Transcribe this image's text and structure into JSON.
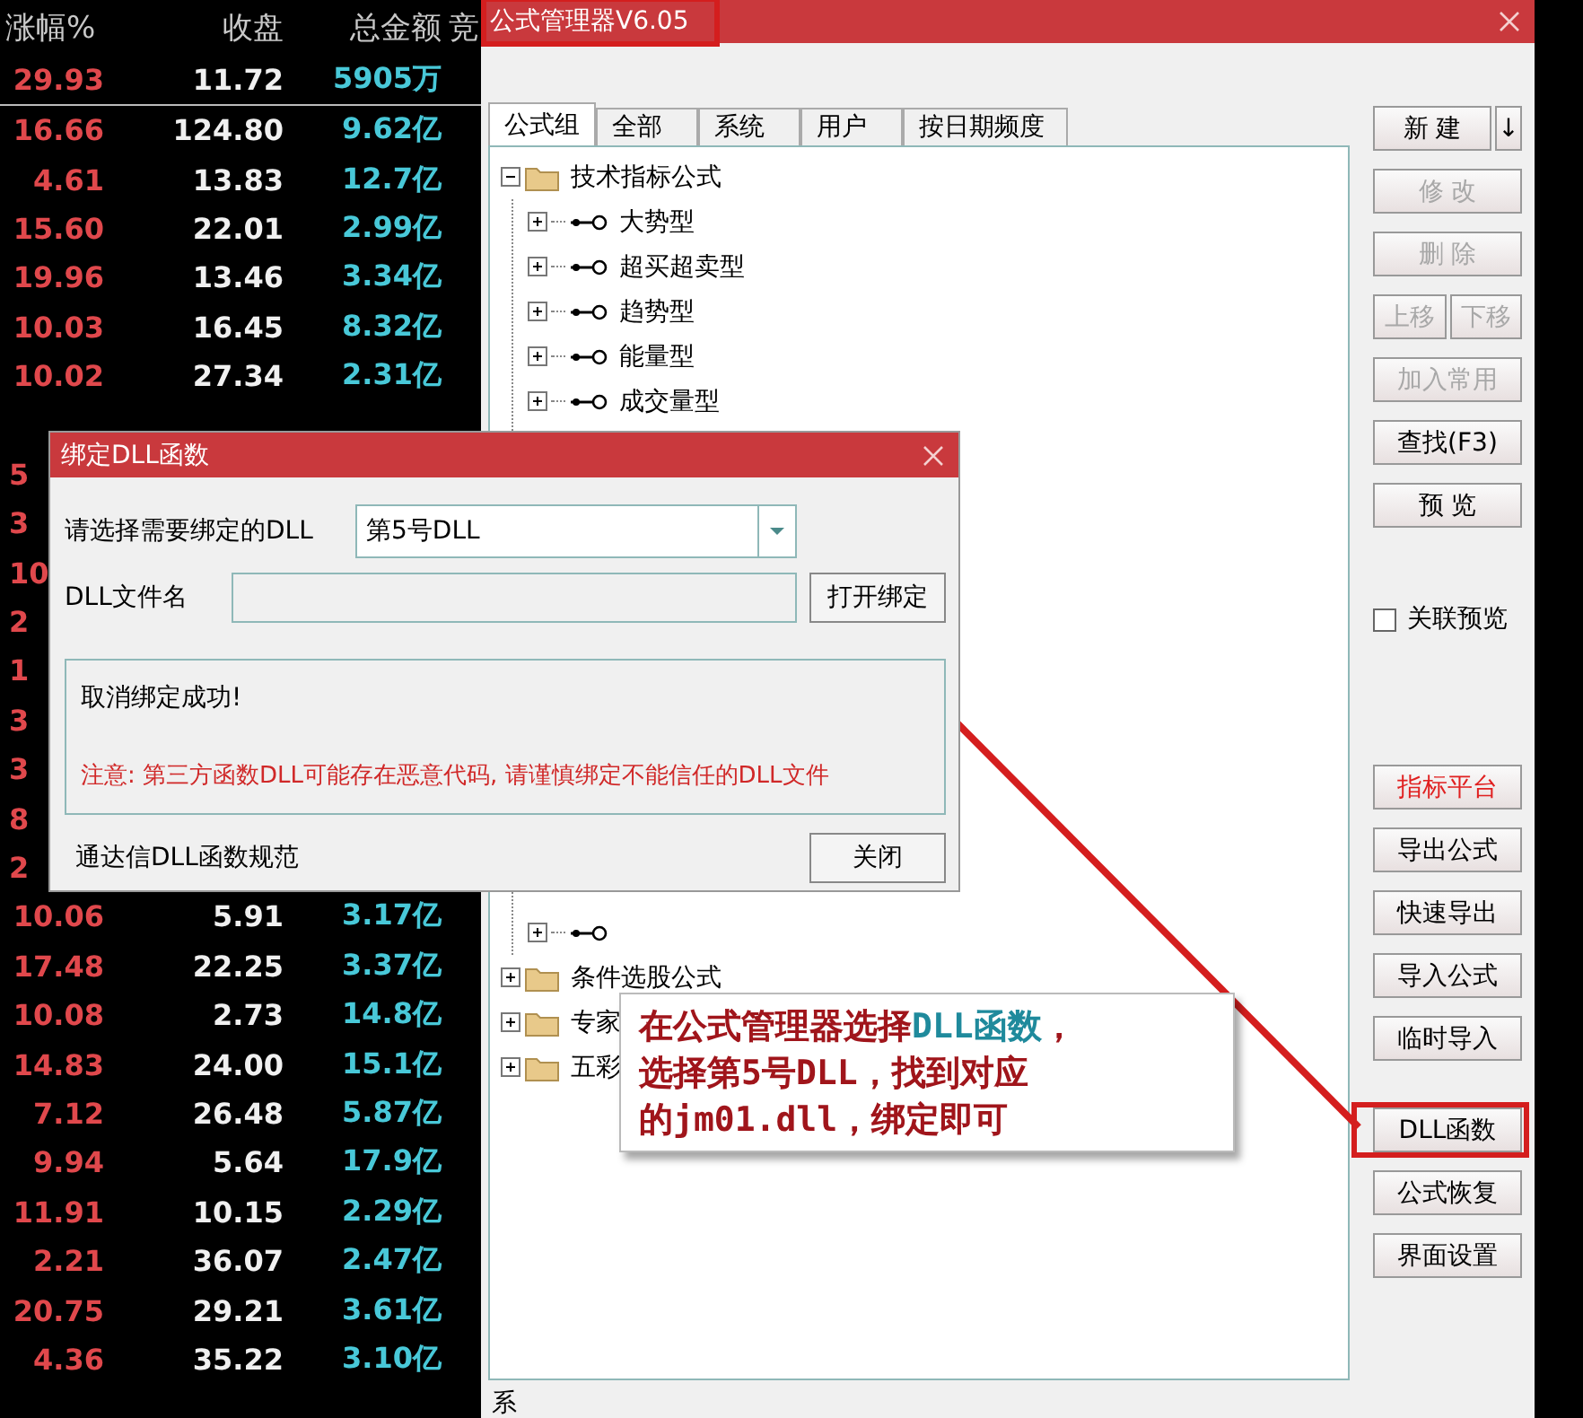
{
  "quotes_table": {
    "columns": [
      "涨幅%",
      "收盘",
      "总金额",
      "竞"
    ],
    "pinned_rows": [
      {
        "cells": [
          "29.93",
          "11.72",
          "5905万"
        ]
      }
    ],
    "rows": [
      {
        "cells": [
          "16.66",
          "124.80",
          "9.62亿"
        ]
      },
      {
        "cells": [
          "4.61",
          "13.83",
          "12.7亿"
        ]
      },
      {
        "cells": [
          "15.60",
          "22.01",
          "2.99亿"
        ]
      },
      {
        "cells": [
          "19.96",
          "13.46",
          "3.34亿"
        ]
      },
      {
        "cells": [
          "10.03",
          "16.45",
          "8.32亿"
        ]
      },
      {
        "cells": [
          "10.02",
          "27.34",
          "2.31亿"
        ]
      }
    ],
    "partial_rows": [
      {
        "cells": [
          "5"
        ]
      },
      {
        "cells": [
          "3"
        ]
      },
      {
        "cells": [
          "10"
        ]
      },
      {
        "cells": [
          "2"
        ]
      },
      {
        "cells": [
          "1"
        ]
      },
      {
        "cells": [
          "3"
        ]
      },
      {
        "cells": [
          "3"
        ]
      },
      {
        "cells": [
          "8"
        ]
      },
      {
        "cells": [
          "2"
        ]
      }
    ],
    "lower_rows": [
      {
        "cells": [
          "10.06",
          "5.91",
          "3.17亿"
        ]
      },
      {
        "cells": [
          "17.48",
          "22.25",
          "3.37亿"
        ]
      },
      {
        "cells": [
          "10.08",
          "2.73",
          "14.8亿"
        ]
      },
      {
        "cells": [
          "14.83",
          "24.00",
          "15.1亿"
        ]
      },
      {
        "cells": [
          "7.12",
          "26.48",
          "5.87亿"
        ]
      },
      {
        "cells": [
          "9.94",
          "5.64",
          "17.9亿"
        ]
      },
      {
        "cells": [
          "11.91",
          "10.15",
          "2.29亿"
        ]
      },
      {
        "cells": [
          "2.21",
          "36.07",
          "2.47亿"
        ]
      },
      {
        "cells": [
          "20.75",
          "29.21",
          "3.61亿"
        ]
      },
      {
        "cells": [
          "4.36",
          "35.22",
          "3.10亿"
        ]
      }
    ]
  },
  "formula_manager": {
    "title": "公式管理器V6.05",
    "title_annotated": true,
    "tabs": [
      {
        "label": "公式组",
        "selected": true
      },
      {
        "label": "全部",
        "selected": false
      },
      {
        "label": "系统",
        "selected": false
      },
      {
        "label": "用户",
        "selected": false
      },
      {
        "label": "按日期频度",
        "selected": false
      }
    ],
    "tree": [
      {
        "label": "技术指标公式",
        "expanded": true,
        "children": [
          {
            "label": "大势型",
            "expanded": false
          },
          {
            "label": "超买超卖型",
            "expanded": false
          },
          {
            "label": "趋势型",
            "expanded": false
          },
          {
            "label": "能量型",
            "expanded": false
          },
          {
            "label": "成交量型",
            "expanded": false
          },
          {
            "expanded": false
          }
        ]
      },
      {
        "label": "条件选股公式",
        "expanded": false
      },
      {
        "label": "专家",
        "expanded": false
      },
      {
        "label": "五彩",
        "expanded": false
      }
    ],
    "button_groups": [
      [
        [
          {
            "label": "新 建",
            "disabled": false,
            "kind": "wide"
          },
          {
            "label": "↓",
            "disabled": false,
            "kind": "narrow"
          }
        ],
        [
          {
            "label": "修 改",
            "disabled": true,
            "kind": "wide"
          }
        ],
        [
          {
            "label": "删 除",
            "disabled": true,
            "kind": "wide"
          }
        ],
        [
          {
            "label": "上移",
            "disabled": true,
            "kind": "half"
          },
          {
            "label": "下移",
            "disabled": true,
            "kind": "half"
          }
        ],
        [
          {
            "label": "加入常用",
            "disabled": true,
            "kind": "wide"
          }
        ],
        [
          {
            "label": "查找(F3)",
            "disabled": false,
            "kind": "wide"
          }
        ],
        [
          {
            "label": "预 览",
            "disabled": false,
            "kind": "wide"
          }
        ]
      ],
      [
        [
          {
            "label": "指标平台",
            "disabled": false,
            "kind": "accent"
          }
        ],
        [
          {
            "label": "导出公式",
            "disabled": false,
            "kind": "wide"
          }
        ],
        [
          {
            "label": "快速导出",
            "disabled": false,
            "kind": "wide"
          }
        ],
        [
          {
            "label": "导入公式",
            "disabled": false,
            "kind": "wide"
          }
        ],
        [
          {
            "label": "临时导入",
            "disabled": false,
            "kind": "wide"
          }
        ]
      ],
      [
        [
          {
            "label": "DLL函数",
            "disabled": false,
            "kind": "wide",
            "annotated": true
          }
        ],
        [
          {
            "label": "公式恢复",
            "disabled": false,
            "kind": "wide"
          }
        ],
        [
          {
            "label": "界面设置",
            "disabled": false,
            "kind": "wide"
          }
        ]
      ]
    ],
    "preview_checkbox": {
      "label": "关联预览",
      "checked": false
    },
    "footer_text": "系"
  },
  "bind_dialog": {
    "title": "绑定DLL函数",
    "select_label": "请选择需要绑定的DLL",
    "select_value": "第5号DLL",
    "file_label": "DLL文件名",
    "open_button": "打开绑定",
    "status": "取消绑定成功!",
    "warning": "注意: 第三方函数DLL可能存在恶意代码, 请谨慎绑定不能信任的DLL文件",
    "spec_text": "通达信DLL函数规范",
    "close_button": "关闭"
  },
  "callout": {
    "lines": [
      [
        {
          "text": "在公式管理器选择",
          "highlight": false
        },
        {
          "text": "DLL函数",
          "highlight": true
        },
        {
          "text": "，",
          "highlight": false
        }
      ],
      [
        {
          "text": "选择第5号DLL，找到对应",
          "highlight": false
        }
      ],
      [
        {
          "text": "的jm01.dll，绑定即可",
          "highlight": false
        }
      ]
    ]
  }
}
